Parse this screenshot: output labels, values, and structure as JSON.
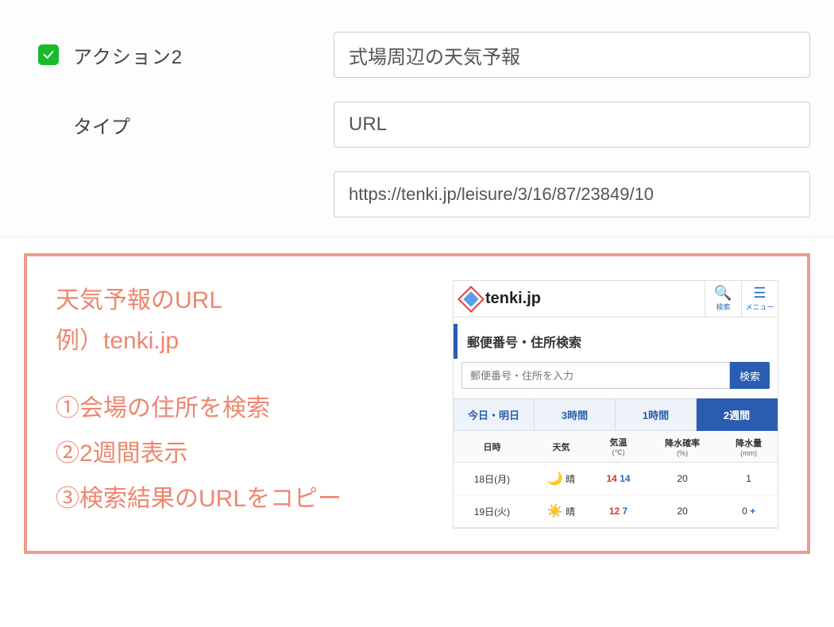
{
  "form": {
    "action_label": "アクション2",
    "action_value": "式場周辺の天気予報",
    "type_label": "タイプ",
    "type_value": "URL",
    "url_value": "https://tenki.jp/leisure/3/16/87/23849/10"
  },
  "panel": {
    "heading_line1": "天気予報のURL",
    "heading_line2": "例）tenki.jp",
    "step1": "①会場の住所を検索",
    "step2": "②2週間表示",
    "step3": "③検索結果のURLをコピー"
  },
  "tenki": {
    "brand": "tenki.jp",
    "search_icon_caption": "検索",
    "menu_icon_caption": "メニュー",
    "section_title": "郵便番号・住所検索",
    "search_placeholder": "郵便番号・住所を入力",
    "search_button": "検索",
    "tabs": [
      "今日・明日",
      "3時間",
      "1時間",
      "2週間"
    ],
    "active_tab_index": 3,
    "table_headers": {
      "date": "日時",
      "weather": "天気",
      "temp": "気温",
      "temp_unit": "(℃)",
      "pop": "降水確率",
      "pop_unit": "(%)",
      "precip": "降水量",
      "precip_unit": "(mm)"
    },
    "rows": [
      {
        "date": "18日(月)",
        "icon": "🌙",
        "icon_name": "moon-icon",
        "wtxt": "晴",
        "hi": "14",
        "lo": "14",
        "pop": "20",
        "precip": "1",
        "plus": ""
      },
      {
        "date": "19日(火)",
        "icon": "☀️",
        "icon_name": "sun-icon",
        "wtxt": "晴",
        "hi": "12",
        "lo": "7",
        "pop": "20",
        "precip": "0",
        "plus": "+"
      }
    ]
  }
}
